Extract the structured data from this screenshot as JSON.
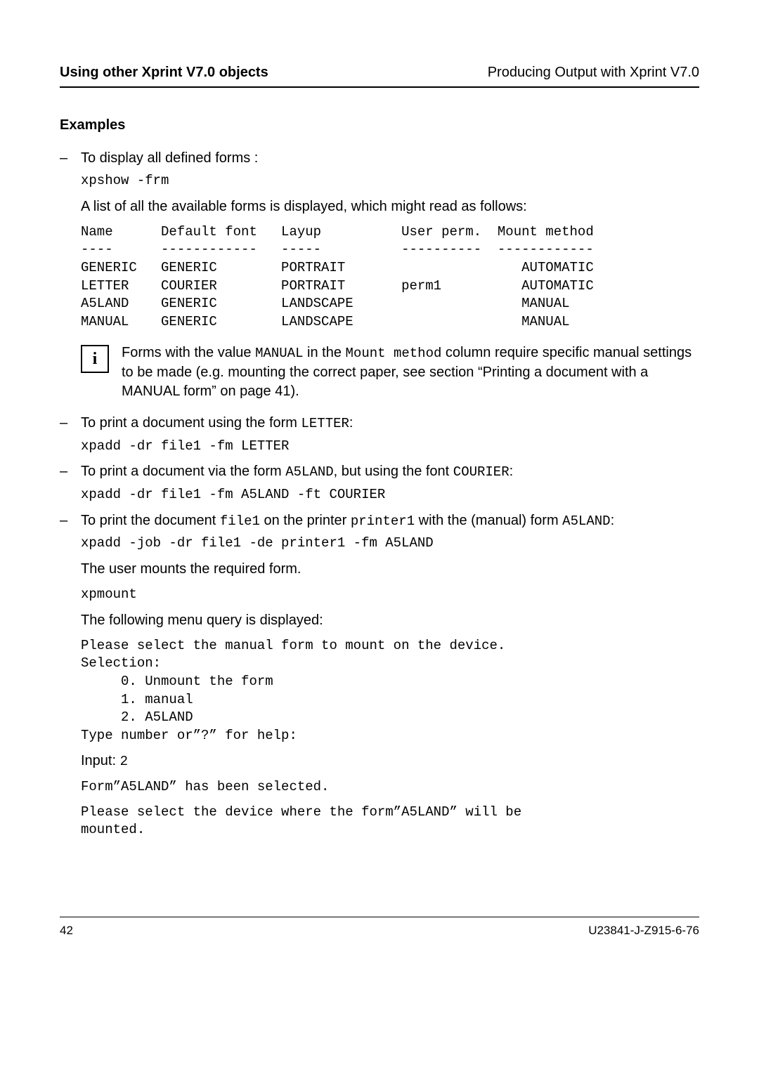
{
  "header": {
    "left": "Using other Xprint V7.0 objects",
    "right": "Producing Output with Xprint V7.0"
  },
  "examples_heading": "Examples",
  "items": {
    "item1_intro": "To display all defined forms :",
    "item1_cmd": "xpshow -frm",
    "item1_result": "A list of all the available forms is displayed, which might read as follows:",
    "table": "Name      Default font   Layup          User perm.  Mount method\n----      ------------   -----          ----------  ------------\nGENERIC   GENERIC        PORTRAIT                      AUTOMATIC\nLETTER    COURIER        PORTRAIT       perm1          AUTOMATIC\nA5LAND    GENERIC        LANDSCAPE                     MANUAL\nMANUAL    GENERIC        LANDSCAPE                     MANUAL",
    "info_1": "Forms with the value ",
    "info_manual": "MANUAL",
    "info_2": " in the ",
    "info_mount": "Mount method",
    "info_3": " column require specific manual settings to be made (e.g. mounting the correct paper, see section “Printing a document with a MANUAL form” on page 41).",
    "item2_a": "To print a document using the form ",
    "item2_b": "LETTER",
    "item2_c": ":",
    "item2_cmd": "xpadd -dr file1 -fm LETTER",
    "item3_a": "To print a document via the form ",
    "item3_b": "A5LAND",
    "item3_c": ", but using the font ",
    "item3_d": "COURIER",
    "item3_e": ":",
    "item3_cmd": "xpadd -dr file1 -fm A5LAND -ft COURIER",
    "item4_a": "To print the document ",
    "item4_b": "file1",
    "item4_c": " on the printer ",
    "item4_d": "printer1",
    "item4_e": " with the (manual) form ",
    "item4_f": "A5LAND",
    "item4_g": ":",
    "item4_cmd": "xpadd -job -dr file1 -de printer1 -fm A5LAND",
    "item4_mount": "The user mounts the required form.",
    "item4_xpmount": "xpmount",
    "item4_menutext": "The following menu query is displayed:",
    "item4_menu": "Please select the manual form to mount on the device.\nSelection:\n     0. Unmount the form\n     1. manual\n     2. A5LAND\nType number or”?” for help:",
    "item4_input_a": "Input: ",
    "item4_input_b": "2",
    "item4_formsel": "Form”A5LAND” has been selected.",
    "item4_please": "Please select the device where the form”A5LAND” will be\nmounted."
  },
  "footer": {
    "page": "42",
    "doc": "U23841-J-Z915-6-76"
  },
  "dash": "–"
}
